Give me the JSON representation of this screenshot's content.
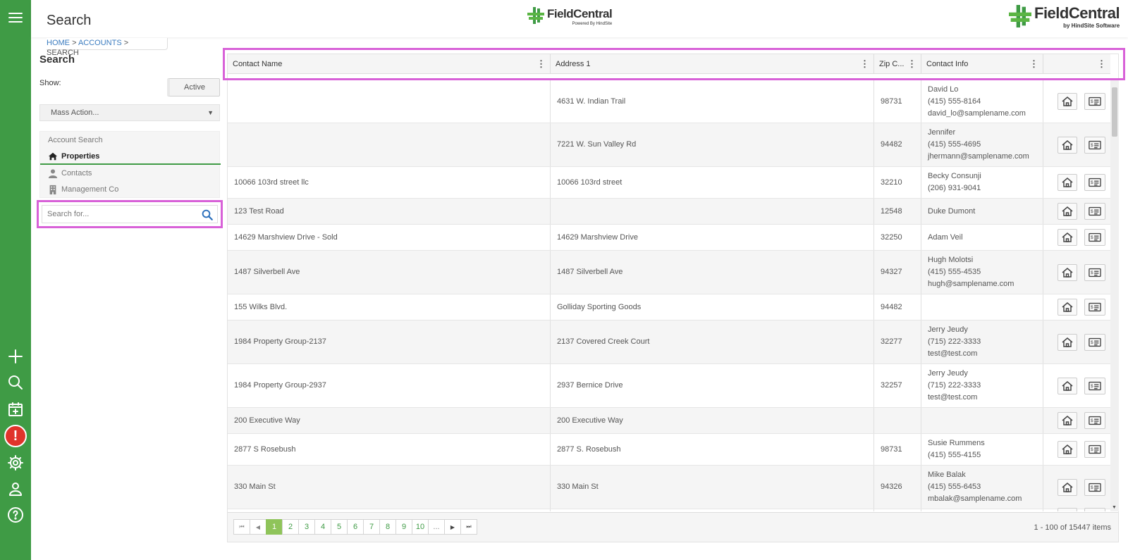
{
  "app": {
    "title": "Search"
  },
  "breadcrumb": {
    "home": "HOME",
    "accounts": "ACCOUNTS",
    "current": "SEARCH",
    "sep": ">"
  },
  "logos": {
    "center": {
      "name": "FieldCentral",
      "sub": "Powered By HindSite"
    },
    "right": {
      "name": "FieldCentral",
      "sub": "by HindSite Software"
    }
  },
  "rail": {
    "alert_glyph": "!"
  },
  "sidebar": {
    "title": "Search",
    "show_label": "Show:",
    "toggle_label": "Active",
    "mass_action": "Mass Action...",
    "account_search_label": "Account Search",
    "items": [
      {
        "label": "Properties",
        "icon": "home-icon"
      },
      {
        "label": "Contacts",
        "icon": "person-icon"
      },
      {
        "label": "Management Co",
        "icon": "building-icon"
      }
    ],
    "search_placeholder": "Search for..."
  },
  "grid": {
    "columns": [
      "Contact Name",
      "Address 1",
      "Zip C...",
      "Contact Info",
      ""
    ],
    "rows": [
      {
        "name": "",
        "address": "4631 W. Indian Trail",
        "zip": "98731",
        "contact": [
          "David Lo",
          "(415) 555-8164",
          "david_lo@samplename.com"
        ]
      },
      {
        "name": "",
        "address": "7221 W. Sun Valley Rd",
        "zip": "94482",
        "contact": [
          "Jennifer",
          "(415) 555-4695",
          "jhermann@samplename.com"
        ]
      },
      {
        "name": "10066 103rd street llc",
        "address": "10066 103rd street",
        "zip": "32210",
        "contact": [
          "Becky Consunji",
          "(206) 931-9041"
        ]
      },
      {
        "name": "123 Test Road",
        "address": "",
        "zip": "12548",
        "contact": [
          "Duke Dumont"
        ]
      },
      {
        "name": "14629 Marshview Drive - Sold",
        "address": "14629 Marshview Drive",
        "zip": "32250",
        "contact": [
          "Adam Veil"
        ]
      },
      {
        "name": "1487 Silverbell Ave",
        "address": "1487 Silverbell Ave",
        "zip": "94327",
        "contact": [
          "Hugh Molotsi",
          "(415) 555-4535",
          "hugh@samplename.com"
        ]
      },
      {
        "name": "155 Wilks Blvd.",
        "address": "Golliday Sporting Goods",
        "zip": "94482",
        "contact": []
      },
      {
        "name": "1984 Property Group-2137",
        "address": "2137 Covered Creek Court",
        "zip": "32277",
        "contact": [
          "Jerry Jeudy",
          "(715) 222-3333",
          "test@test.com"
        ]
      },
      {
        "name": "1984 Property Group-2937",
        "address": "2937 Bernice Drive",
        "zip": "32257",
        "contact": [
          "Jerry Jeudy",
          "(715) 222-3333",
          "test@test.com"
        ]
      },
      {
        "name": "200 Executive Way",
        "address": "200 Executive Way",
        "zip": "",
        "contact": []
      },
      {
        "name": "2877 S Rosebush",
        "address": "2877 S. Rosebush",
        "zip": "98731",
        "contact": [
          "Susie Rummens",
          "(415) 555-4155"
        ]
      },
      {
        "name": "330 Main St",
        "address": "330 Main St",
        "zip": "94326",
        "contact": [
          "Mike Balak",
          "(415) 555-6453",
          "mbalak@samplename.com"
        ]
      },
      {
        "name": "",
        "address": "",
        "zip": "",
        "contact": []
      }
    ]
  },
  "pager": {
    "pages": [
      "1",
      "2",
      "3",
      "4",
      "5",
      "6",
      "7",
      "8",
      "9",
      "10",
      "..."
    ],
    "current": "1",
    "info": "1 - 100 of 15447 items"
  },
  "colors": {
    "brand_green": "#3f9b45",
    "highlight": "#d861d8",
    "alert_red": "#e0332b",
    "pager_active": "#8fc45a"
  }
}
